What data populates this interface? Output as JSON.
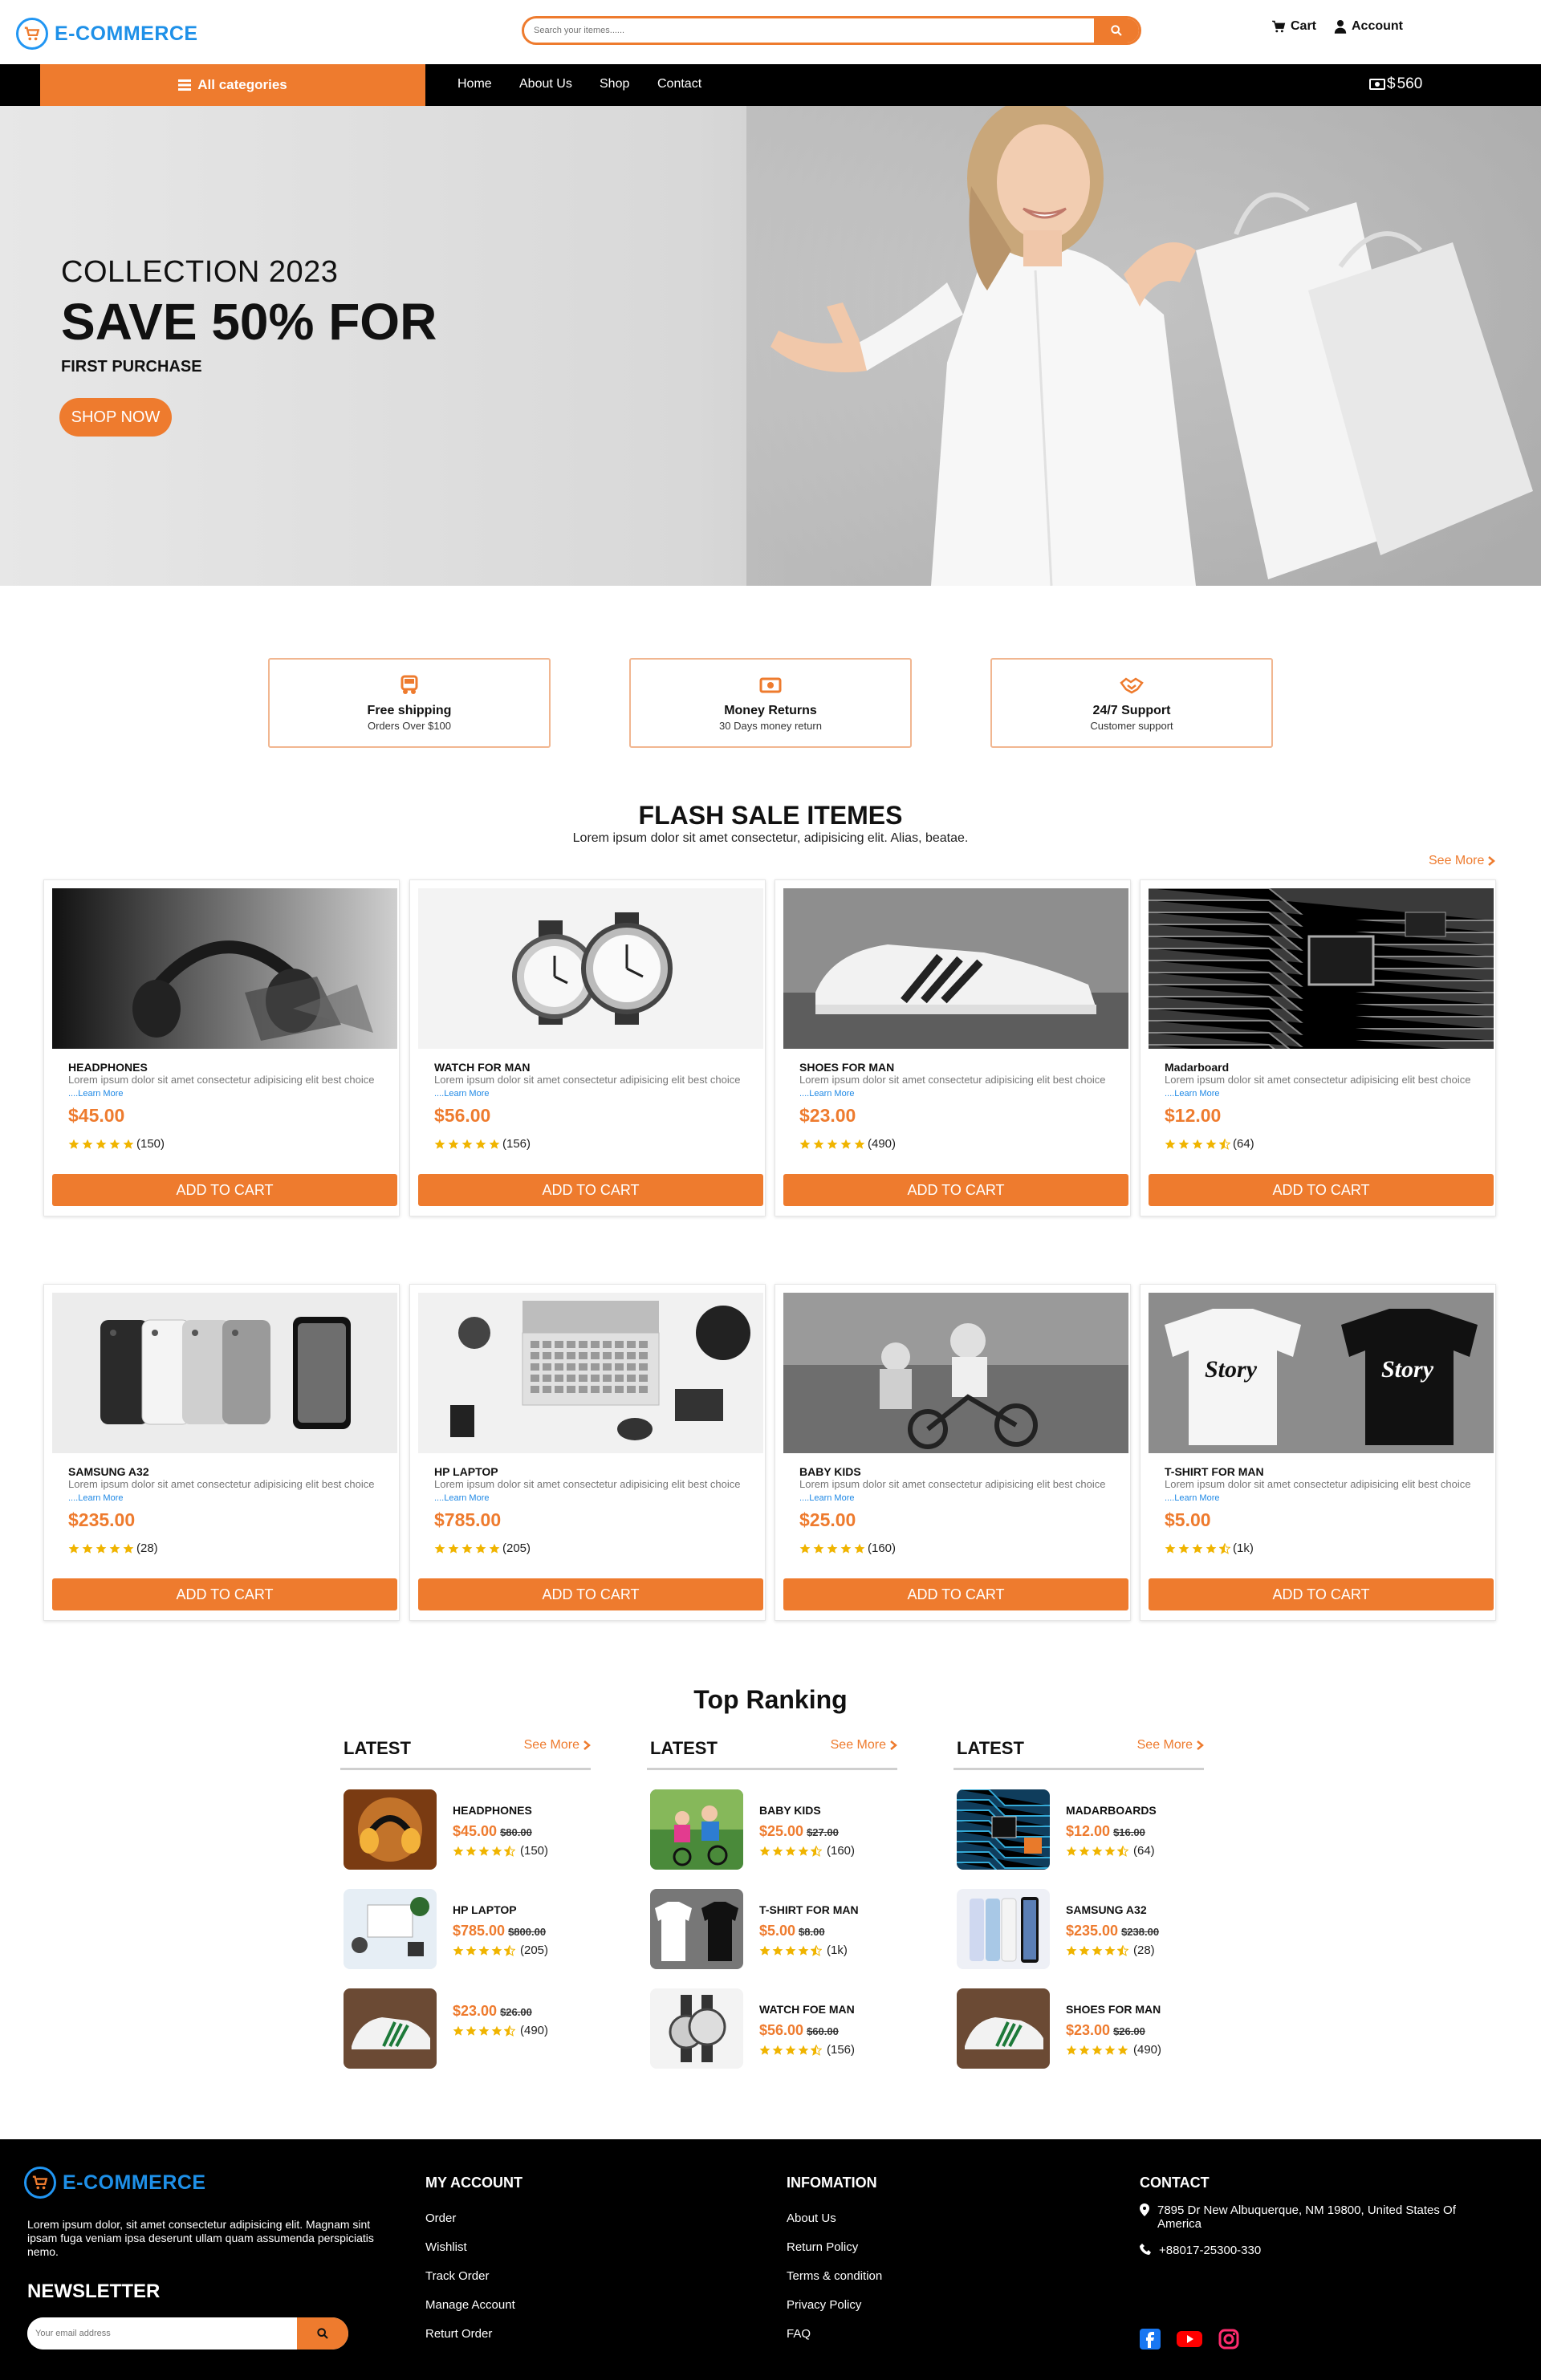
{
  "header": {
    "brand": "E-COMMERCE",
    "search_placeholder": "Search your itemes......",
    "cart_label": "Cart",
    "account_label": "Account"
  },
  "nav": {
    "all_categories": "All categories",
    "links": [
      "Home",
      "About Us",
      "Shop",
      "Contact"
    ],
    "balance": "560"
  },
  "hero": {
    "line1": "COLLECTION 2023",
    "line2": "SAVE 50% FOR",
    "line3": "FIRST PURCHASE",
    "button": "SHOP NOW"
  },
  "features": [
    {
      "title": "Free shipping",
      "subtitle": "Orders Over $100",
      "icon": "truck-icon"
    },
    {
      "title": "Money Returns",
      "subtitle": "30 Days money return",
      "icon": "money-icon"
    },
    {
      "title": "24/7 Support",
      "subtitle": "Customer support",
      "icon": "handshake-icon"
    }
  ],
  "flash": {
    "title": "FLASH SALE ITEMES",
    "subtitle": "Lorem ipsum dolor sit amet consectetur, adipisicing elit. Alias, beatae.",
    "see_more": "See More",
    "desc": "Lorem ipsum dolor sit amet consectetur adipisicing elit best choice",
    "learn_more": "....Learn More",
    "add_to_cart": "ADD TO CART",
    "products": [
      {
        "name": "HEADPHONES",
        "price": "$45.00",
        "stars": 5,
        "reviews": "(150)"
      },
      {
        "name": "WATCH FOR MAN",
        "price": "$56.00",
        "stars": 5,
        "reviews": "(156)"
      },
      {
        "name": "SHOES FOR MAN",
        "price": "$23.00",
        "stars": 5,
        "reviews": "(490)"
      },
      {
        "name": "Madarboard",
        "price": "$12.00",
        "stars": 4.5,
        "reviews": "(64)"
      },
      {
        "name": "SAMSUNG A32",
        "price": "$235.00",
        "stars": 5,
        "reviews": "(28)"
      },
      {
        "name": "HP LAPTOP",
        "price": "$785.00",
        "stars": 5,
        "reviews": "(205)"
      },
      {
        "name": "BABY KIDS",
        "price": "$25.00",
        "stars": 5,
        "reviews": "(160)"
      },
      {
        "name": "T-SHIRT FOR MAN",
        "price": "$5.00",
        "stars": 4.5,
        "reviews": "(1k)"
      }
    ]
  },
  "ranking": {
    "title": "Top Ranking",
    "see_more": "See More",
    "columns": [
      {
        "label": "LATEST",
        "items": [
          {
            "name": "HEADPHONES",
            "price": "$45.00",
            "old": "$80.00",
            "reviews": "(150)"
          },
          {
            "name": "HP LAPTOP",
            "price": "$785.00",
            "old": "$800.00",
            "reviews": "(205)"
          },
          {
            "name": "",
            "price": "$23.00",
            "old": "$26.00",
            "reviews": "(490)"
          }
        ]
      },
      {
        "label": "LATEST",
        "items": [
          {
            "name": "BABY KIDS",
            "price": "$25.00",
            "old": "$27.00",
            "reviews": "(160)"
          },
          {
            "name": "T-SHIRT FOR MAN",
            "price": "$5.00",
            "old": "$8.00",
            "reviews": "(1k)"
          },
          {
            "name": "WATCH FOE MAN",
            "price": "$56.00",
            "old": "$60.00",
            "reviews": "(156)"
          }
        ]
      },
      {
        "label": "LATEST",
        "items": [
          {
            "name": "MADARBOARDS",
            "price": "$12.00",
            "old": "$16.00",
            "reviews": "(64)"
          },
          {
            "name": "SAMSUNG A32",
            "price": "$235.00",
            "old": "$238.00",
            "reviews": "(28)"
          },
          {
            "name": "SHOES FOR MAN",
            "price": "$23.00",
            "old": "$26.00",
            "reviews": "(490)"
          }
        ]
      }
    ]
  },
  "footer": {
    "brand": "E-COMMERCE",
    "about": "Lorem ipsum dolor, sit amet consectetur adipisicing elit. Magnam sint ipsam fuga veniam ipsa deserunt ullam quam assumenda perspiciatis nemo.",
    "newsletter_title": "NEWSLETTER",
    "email_placeholder": "Your email address",
    "my_account": {
      "title": "MY ACCOUNT",
      "links": [
        "Order",
        "Wishlist",
        "Track Order",
        "Manage Account",
        "Returt Order"
      ]
    },
    "information": {
      "title": "INFOMATION",
      "links": [
        "About Us",
        "Return Policy",
        "Terms & condition",
        "Privacy Policy",
        "FAQ"
      ]
    },
    "contact": {
      "title": "CONTACT",
      "address": "7895 Dr New Albuquerque, NM 19800, United States Of America",
      "phone": "+88017-25300-330"
    }
  },
  "colors": {
    "accent": "#ee7b2e",
    "brand_blue": "#1e90e8",
    "nav_bg": "#000000",
    "star": "#f0b400"
  }
}
